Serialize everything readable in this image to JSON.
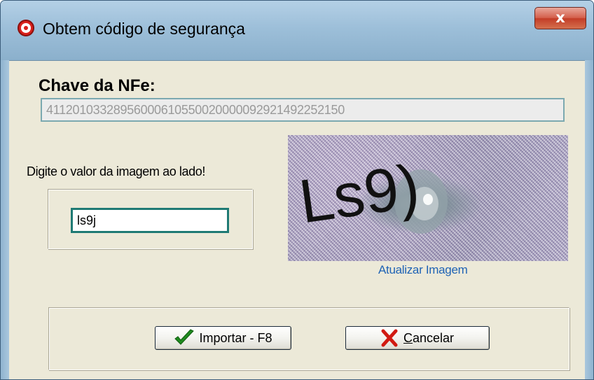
{
  "window": {
    "title": "Obtem código de segurança",
    "close_label": "x"
  },
  "key_section": {
    "label": "Chave da NFe:",
    "value": "41120103328956000610550020000092921492252150"
  },
  "captcha": {
    "prompt": "Digite o valor da  imagem ao lado!",
    "input_value": "ls9j",
    "image_text": "Ls9)",
    "refresh_link": "Atualizar Imagem"
  },
  "buttons": {
    "import_label": "Importar - F8",
    "cancel_label": "Cancelar"
  },
  "icons": {
    "title": "app-target-icon",
    "close": "close-icon",
    "import": "checkmark-icon",
    "cancel": "red-x-icon"
  },
  "colors": {
    "client_background": "#ece9d8",
    "link": "#1f63b5",
    "input_border": "#1f7a74",
    "close_button": "#c33d27",
    "check_icon": "#1f8a1f",
    "cancel_icon": "#d11a12"
  }
}
